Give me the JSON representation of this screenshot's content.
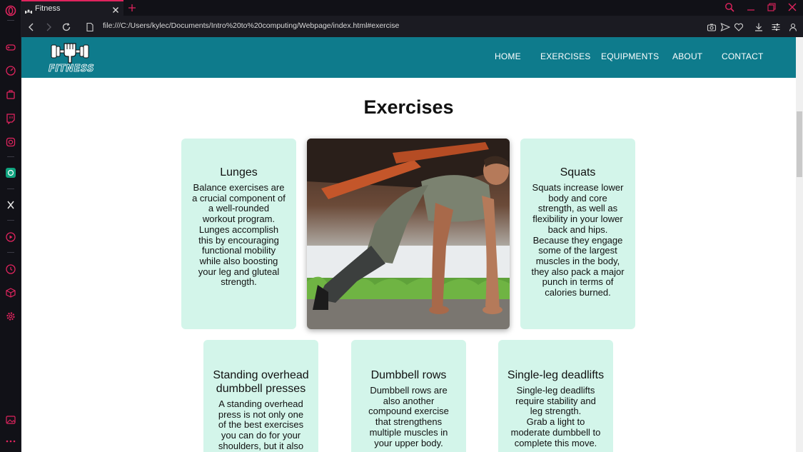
{
  "browser": {
    "tab_title": "Fitness",
    "url": "file:///C:/Users/kylec/Documents/Intro%20to%20computing/Webpage/index.html#exercise",
    "accent_color": "#e0245e"
  },
  "site": {
    "logo_text": "FITNESS",
    "header_color": "#0e7b8c",
    "nav": [
      "HOME",
      "EXERCISES",
      "EQUIPMENTS",
      "ABOUT",
      "CONTACT"
    ]
  },
  "exercises": {
    "title": "Exercises",
    "card_color": "#d3f5ea",
    "cards": [
      {
        "title": "Lunges",
        "lines": [
          "Balance exercises are",
          "a crucial component of",
          "a well-rounded",
          "workout program.",
          "Lunges accomplish",
          "this by encouraging",
          "functional mobility",
          "while also boosting",
          "your leg and gluteal",
          "strength."
        ]
      },
      {
        "title": "Squats",
        "lines": [
          "Squats increase lower",
          "body and core",
          "strength, as well as",
          "flexibility in your lower",
          "back and hips.",
          "Because they engage",
          "some of the largest",
          "muscles in the body,",
          "they also pack a major",
          "punch in terms of",
          "calories burned."
        ]
      },
      {
        "title_lines": [
          "Standing overhead",
          "dumbbell presses"
        ],
        "lines": [
          "A standing overhead",
          "press is not only one",
          "of the best exercises",
          "you can do for your",
          "shoulders, but it also"
        ]
      },
      {
        "title": "Dumbbell rows",
        "lines": [
          "Dumbbell rows are",
          "also another",
          "compound exercise",
          "that strengthens",
          "multiple muscles in",
          "your upper body."
        ]
      },
      {
        "title": "Single-leg deadlifts",
        "lines": [
          "Single-leg deadlifts",
          "require stability and",
          "leg strength.",
          "Grab a light to",
          "moderate dumbbell to",
          "complete this move."
        ]
      }
    ]
  }
}
